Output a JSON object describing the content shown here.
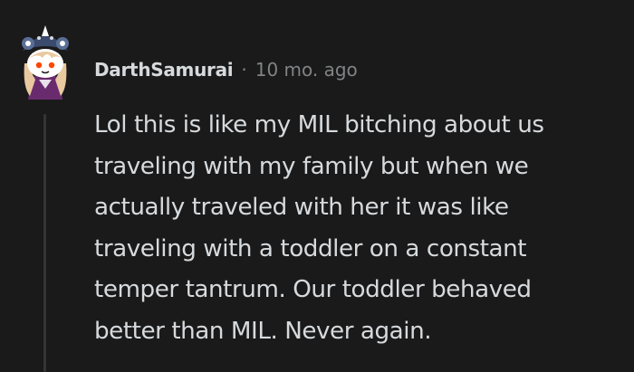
{
  "comment": {
    "username": "DarthSamurai",
    "separator": "·",
    "timestamp": "10 mo. ago",
    "body_lines": [
      "Lol this is like my MIL bitching about us",
      "traveling with my family but when we",
      "actually traveled with her it was like",
      "traveling with a toddler on a constant",
      "temper tantrum. Our toddler behaved",
      "better than MIL. Never again."
    ]
  },
  "avatar": {
    "icon": "snoo-avatar-icon",
    "colors": {
      "head": "#ffffff",
      "hat": "#3a4b6e",
      "hair": "#e8c9a0",
      "outfit": "#6a2b6e",
      "accent": "#ff4500"
    }
  },
  "theme": {
    "background": "#1a1a1b",
    "text": "#d7dadc",
    "muted": "#818384",
    "thread_line": "#343536"
  }
}
